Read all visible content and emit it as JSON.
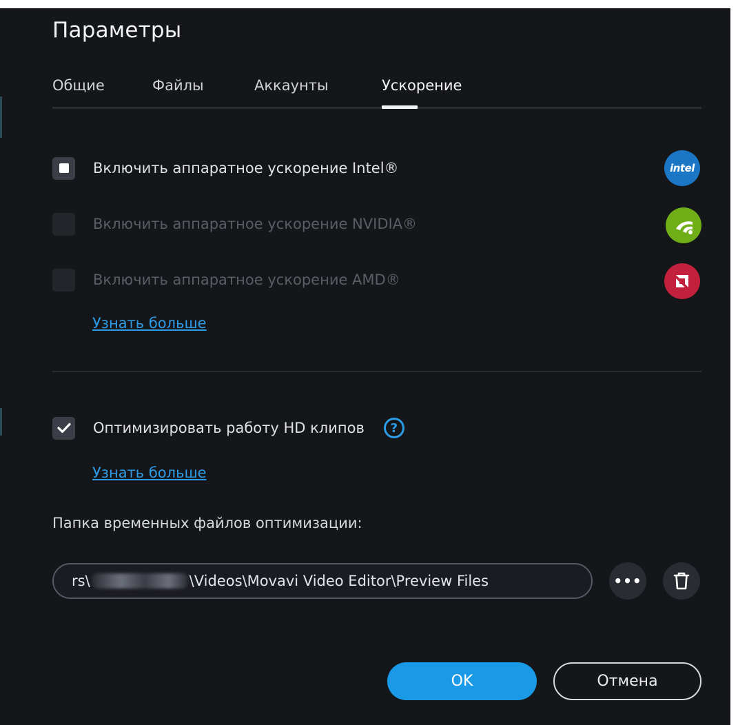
{
  "dialog": {
    "title": "Параметры"
  },
  "tabs": [
    {
      "label": "Общие",
      "active": false
    },
    {
      "label": "Файлы",
      "active": false
    },
    {
      "label": "Аккаунты",
      "active": false
    },
    {
      "label": "Ускорение",
      "active": true
    }
  ],
  "acceleration": {
    "intel": {
      "label": "Включить аппаратное ускорение Intel®",
      "checked": true,
      "enabled": true,
      "logo_text": "intel"
    },
    "nvidia": {
      "label": "Включить аппаратное ускорение NVIDIA®",
      "checked": false,
      "enabled": false
    },
    "amd": {
      "label": "Включить аппаратное ускорение AMD®",
      "checked": false,
      "enabled": false
    },
    "learn_more": "Узнать больше"
  },
  "optimization": {
    "hd_label": "Оптимизировать работу HD клипов",
    "hd_checked": true,
    "help_glyph": "?",
    "learn_more": "Узнать больше",
    "folder_label": "Папка временных файлов оптимизации:",
    "path_prefix": "rs\\",
    "path_suffix": "\\Videos\\Movavi Video Editor\\Preview Files"
  },
  "buttons": {
    "ok": "OK",
    "cancel": "Отмена"
  },
  "colors": {
    "accent": "#1a9ae6",
    "background": "#15161a",
    "link": "#2d9be6",
    "intel": "#1b77c5",
    "nvidia": "#6fae17",
    "amd": "#c2203c"
  }
}
